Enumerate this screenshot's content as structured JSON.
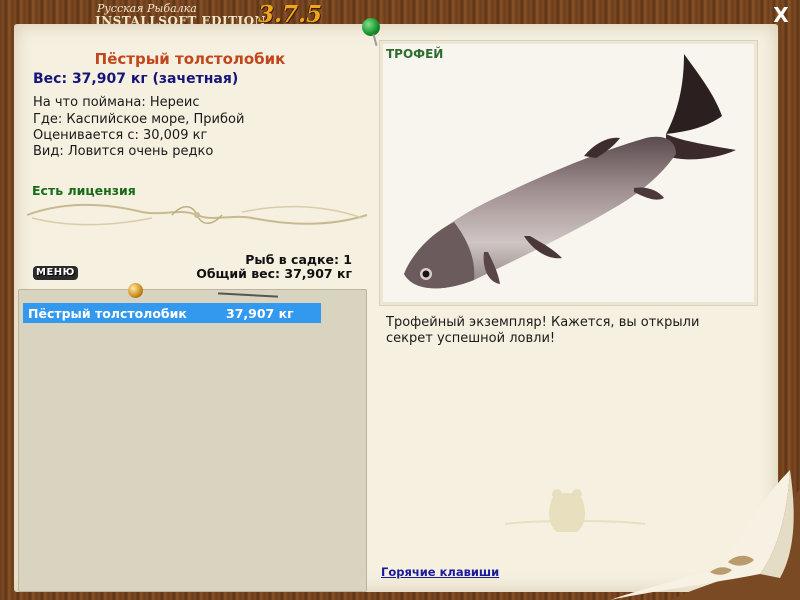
{
  "window": {
    "brand_line1": "Русская Рыбалка",
    "brand_line2": "INSTALLSOFT EDITION",
    "version": "3.7.5",
    "close_label": "X"
  },
  "fish": {
    "name": "Пёстрый толстолобик",
    "weight": "Вес: 37,907 кг (зачетная)",
    "caught_with": "На что поймана: Нереис",
    "location": "Где: Каспийское море, Прибой",
    "min_score_weight": "Оценивается с: 30,009 кг",
    "rarity": "Вид: Ловится очень редко",
    "license": "Есть лицензия"
  },
  "keepnet": {
    "count": "Рыб в садке: 1",
    "total_weight": "Общий вес: 37,907 кг",
    "menu_label": "МЕНЮ",
    "items": [
      {
        "name": "Пёстрый толстолобик",
        "weight": "37,907 кг"
      }
    ]
  },
  "photo": {
    "badge": "ТРОФЕЙ",
    "description": "Трофейный экземпляр! Кажется, вы открыли секрет успешной ловли!"
  },
  "footer": {
    "hotkeys_link": "Горячие клавиши"
  },
  "colors": {
    "fish_name": "#c2461b",
    "weight": "#16167a",
    "license": "#176b17",
    "selection": "#3399ee",
    "version": "#f2a51e"
  }
}
